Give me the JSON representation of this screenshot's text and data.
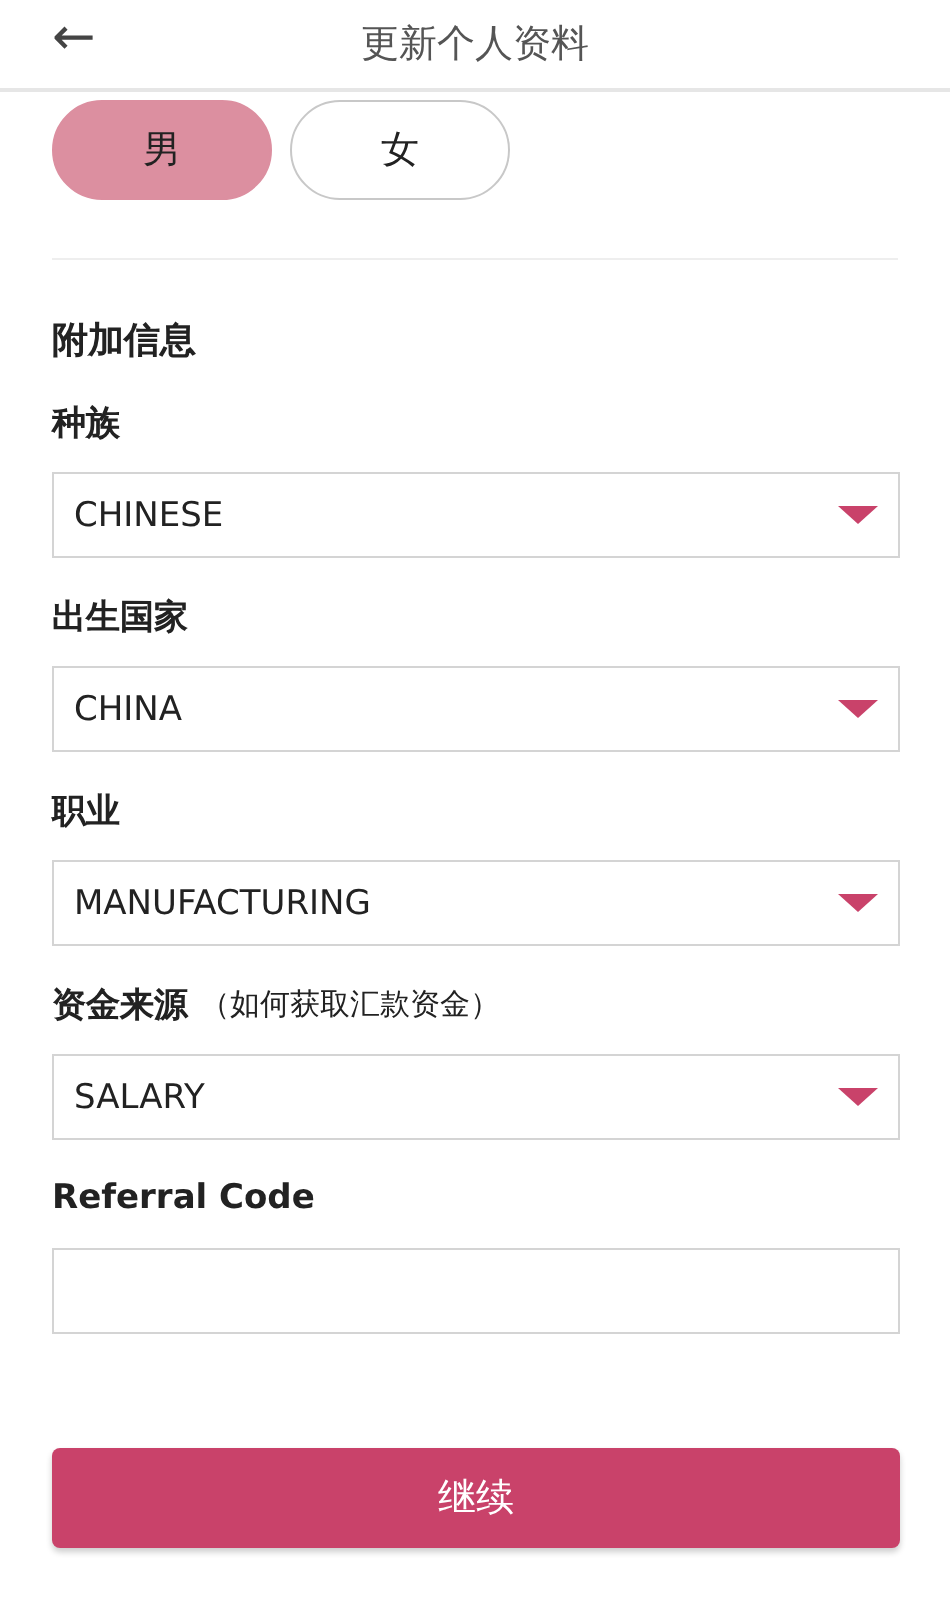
{
  "header": {
    "back": "←",
    "title": "更新个人资料"
  },
  "gender": [
    {
      "label": "男",
      "selected": true
    },
    {
      "label": "女",
      "selected": false
    }
  ],
  "section_title": "附加信息",
  "fields": [
    {
      "kind": "select",
      "label": "种族",
      "value": "CHINESE"
    },
    {
      "kind": "select",
      "label": "出生国家",
      "value": "CHINA"
    },
    {
      "kind": "select",
      "label": "职业",
      "value": "MANUFACTURING"
    },
    {
      "kind": "select",
      "label": "资金来源",
      "note": "（如何获取汇款资金）",
      "value": "SALARY"
    },
    {
      "kind": "text",
      "label": "Referral Code"
    }
  ],
  "submit": "继续"
}
